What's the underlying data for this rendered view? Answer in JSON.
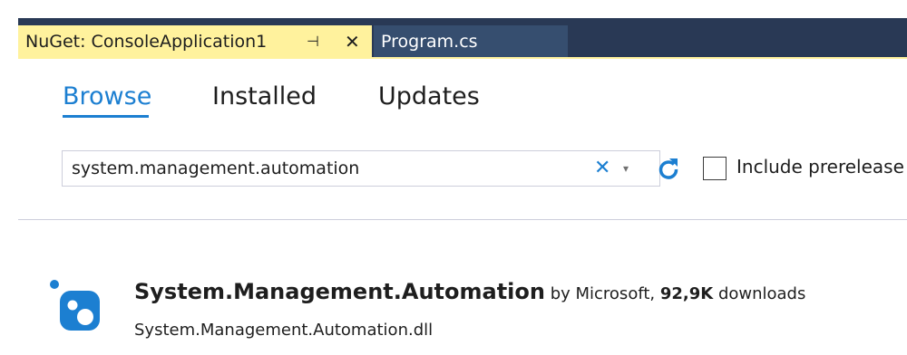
{
  "colors": {
    "tabbar_bg": "#293955",
    "active_tab_bg": "#fff29d",
    "inactive_tab_bg": "#364e6f",
    "accent": "#1c7fd1"
  },
  "tabs": [
    {
      "label": "NuGet: ConsoleApplication1",
      "pin_glyph": "⊣",
      "close_glyph": "✕",
      "active": true
    },
    {
      "label": "Program.cs",
      "active": false
    }
  ],
  "subtabs": [
    "Browse",
    "Installed",
    "Updates"
  ],
  "selected_subtab": "Browse",
  "search": {
    "value": "system.management.automation",
    "clear_glyph": "✕",
    "dropdown_glyph": "▾"
  },
  "icons": {
    "refresh": "refresh-icon",
    "clear": "close-icon",
    "dropdown": "chevron-down-icon",
    "package": "nuget-package-icon"
  },
  "prerelease": {
    "label": "Include prerelease",
    "checked": false
  },
  "package": {
    "name": "System.Management.Automation",
    "by_text": " by Microsoft, ",
    "downloads_count": "92,9K",
    "downloads_suffix": " downloads",
    "description": "System.Management.Automation.dll"
  }
}
